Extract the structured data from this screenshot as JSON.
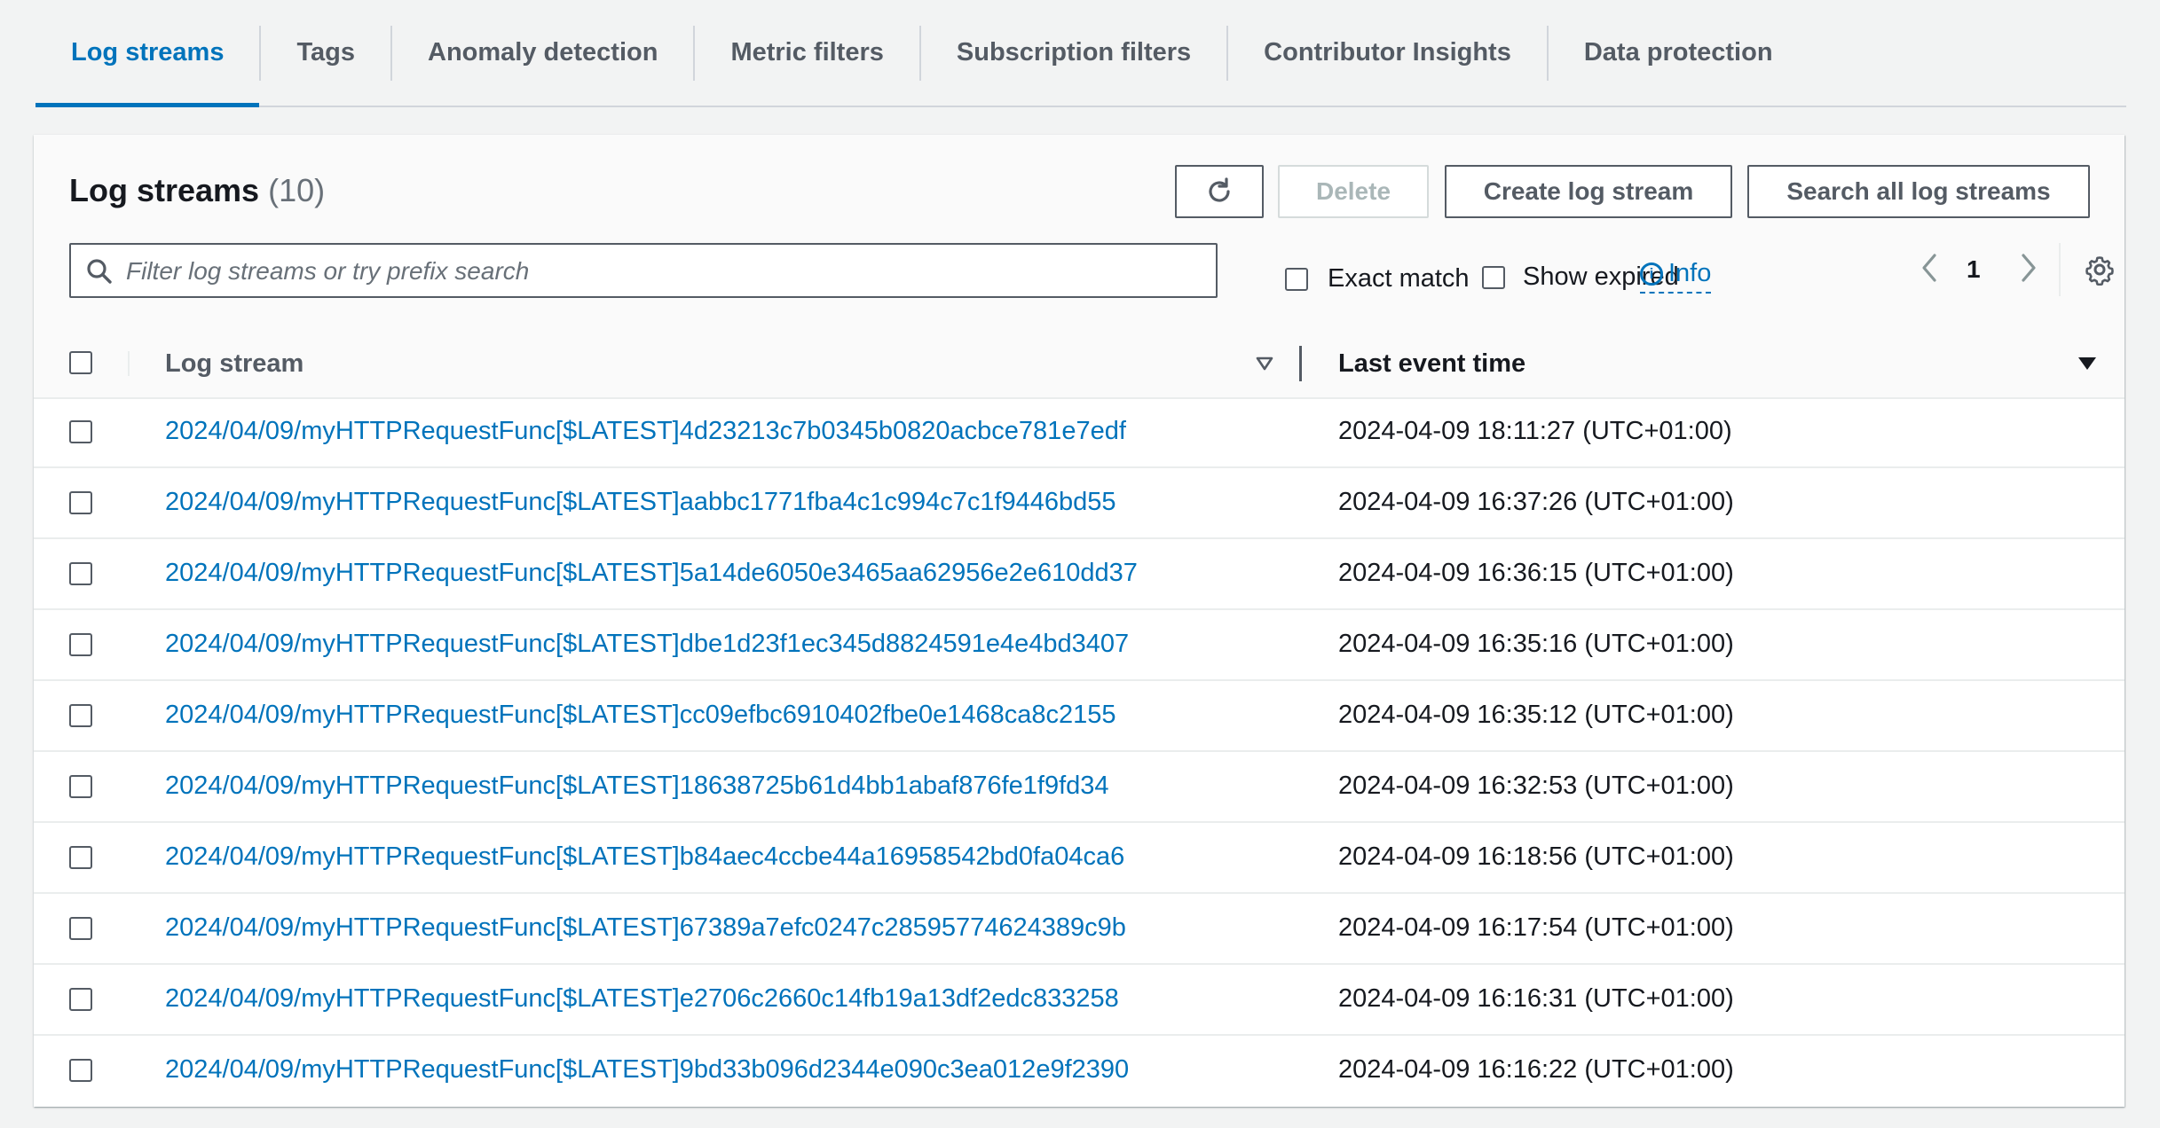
{
  "tabs": [
    {
      "label": "Log streams",
      "active": true
    },
    {
      "label": "Tags"
    },
    {
      "label": "Anomaly detection"
    },
    {
      "label": "Metric filters"
    },
    {
      "label": "Subscription filters"
    },
    {
      "label": "Contributor Insights"
    },
    {
      "label": "Data protection"
    }
  ],
  "panel": {
    "title": "Log streams",
    "count": "(10)",
    "buttons": {
      "delete": "Delete",
      "create": "Create log stream",
      "search_all": "Search all log streams"
    },
    "filter": {
      "placeholder": "Filter log streams or try prefix search",
      "value": ""
    },
    "exact_match": "Exact match",
    "show_expired": "Show expired",
    "info": "Info",
    "page": "1"
  },
  "table": {
    "columns": {
      "stream": "Log stream",
      "time": "Last event time"
    },
    "rows": [
      {
        "stream": "2024/04/09/myHTTPRequestFunc[$LATEST]4d23213c7b0345b0820acbce781e7edf",
        "time": "2024-04-09 18:11:27 (UTC+01:00)"
      },
      {
        "stream": "2024/04/09/myHTTPRequestFunc[$LATEST]aabbc1771fba4c1c994c7c1f9446bd55",
        "time": "2024-04-09 16:37:26 (UTC+01:00)"
      },
      {
        "stream": "2024/04/09/myHTTPRequestFunc[$LATEST]5a14de6050e3465aa62956e2e610dd37",
        "time": "2024-04-09 16:36:15 (UTC+01:00)"
      },
      {
        "stream": "2024/04/09/myHTTPRequestFunc[$LATEST]dbe1d23f1ec345d8824591e4e4bd3407",
        "time": "2024-04-09 16:35:16 (UTC+01:00)"
      },
      {
        "stream": "2024/04/09/myHTTPRequestFunc[$LATEST]cc09efbc6910402fbe0e1468ca8c2155",
        "time": "2024-04-09 16:35:12 (UTC+01:00)"
      },
      {
        "stream": "2024/04/09/myHTTPRequestFunc[$LATEST]18638725b61d4bb1abaf876fe1f9fd34",
        "time": "2024-04-09 16:32:53 (UTC+01:00)"
      },
      {
        "stream": "2024/04/09/myHTTPRequestFunc[$LATEST]b84aec4ccbe44a16958542bd0fa04ca6",
        "time": "2024-04-09 16:18:56 (UTC+01:00)"
      },
      {
        "stream": "2024/04/09/myHTTPRequestFunc[$LATEST]67389a7efc0247c28595774624389c9b",
        "time": "2024-04-09 16:17:54 (UTC+01:00)"
      },
      {
        "stream": "2024/04/09/myHTTPRequestFunc[$LATEST]e2706c2660c14fb19a13df2edc833258",
        "time": "2024-04-09 16:16:31 (UTC+01:00)"
      },
      {
        "stream": "2024/04/09/myHTTPRequestFunc[$LATEST]9bd33b096d2344e090c3ea012e9f2390",
        "time": "2024-04-09 16:16:22 (UTC+01:00)"
      }
    ]
  },
  "icons": [
    "refresh-icon",
    "search-icon",
    "info-icon",
    "chevron-left-icon",
    "chevron-right-icon",
    "gear-icon",
    "sort-icon"
  ],
  "colors": {
    "link": "#0073bb",
    "text": "#16191f",
    "muted": "#545b64",
    "background": "#f2f3f3"
  }
}
